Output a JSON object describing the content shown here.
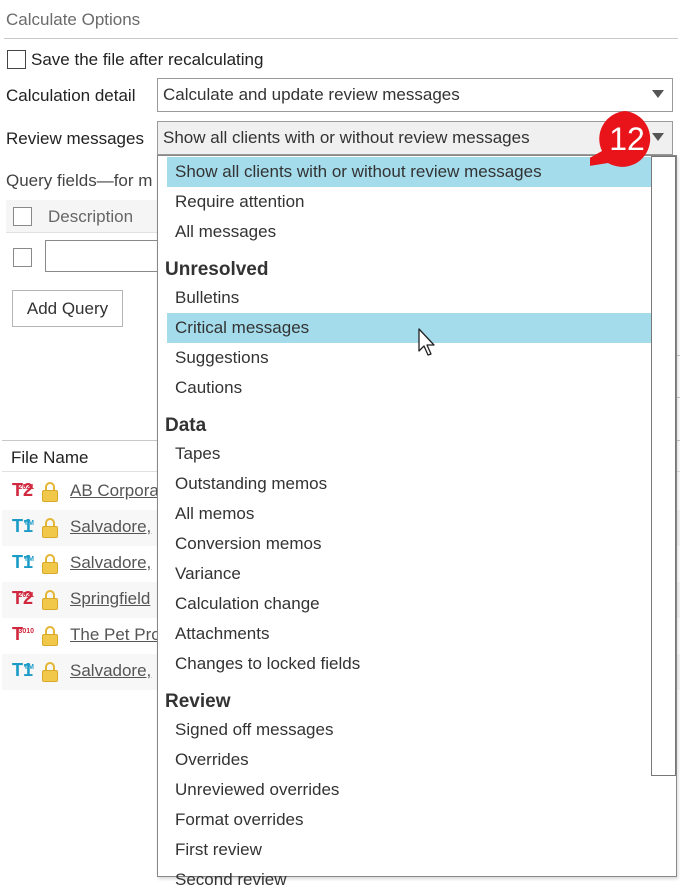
{
  "section_title": "Calculate Options",
  "save_checkbox": {
    "label": "Save the file after recalculating",
    "checked": false
  },
  "calculation_detail": {
    "label": "Calculation detail",
    "value": "Calculate and update review messages"
  },
  "review_messages": {
    "label": "Review messages",
    "value": "Show all clients with or without review messages"
  },
  "query": {
    "label": "Query fields—for m",
    "description_header": "Description",
    "add_button": "Add Query"
  },
  "file_list": {
    "header": "File Name",
    "rows": [
      {
        "badge": "T2",
        "badge_sub": "2021",
        "icon": "t2-return-icon",
        "name": "AB Corpora"
      },
      {
        "badge": "T1",
        "badge_sub": "TM",
        "icon": "t1-return-icon",
        "name": "Salvadore,"
      },
      {
        "badge": "T1",
        "badge_sub": "TM",
        "icon": "t1-return-icon",
        "name": "Salvadore,"
      },
      {
        "badge": "T2",
        "badge_sub": "2021",
        "icon": "t2-return-icon",
        "name": "Springfield"
      },
      {
        "badge": "T",
        "badge_sub": "3010",
        "icon": "t3010-return-icon",
        "name": "The Pet Pro"
      },
      {
        "badge": "T1",
        "badge_sub": "TM",
        "icon": "t1-return-icon",
        "name": "Salvadore,"
      }
    ]
  },
  "dropdown": {
    "selected": "Show all clients with or without review messages",
    "hovered": "Critical messages",
    "top_items": [
      "Show all clients with or without review messages",
      "Require attention",
      "All messages"
    ],
    "groups": [
      {
        "title": "Unresolved",
        "items": [
          "Bulletins",
          "Critical messages",
          "Suggestions",
          "Cautions"
        ]
      },
      {
        "title": "Data",
        "items": [
          "Tapes",
          "Outstanding memos",
          "All memos",
          "Conversion memos",
          "Variance",
          "Calculation change",
          "Attachments",
          "Changes to locked fields"
        ]
      },
      {
        "title": "Review",
        "items": [
          "Signed off messages",
          "Overrides",
          "Unreviewed overrides",
          "Format overrides",
          "First review",
          "Second review"
        ]
      }
    ]
  },
  "callout": {
    "number": "12",
    "color": "#e8141a"
  },
  "colors": {
    "highlight": "#a4dcec",
    "t1": "#1a9bc6",
    "t2": "#d0283e",
    "lock": "#f2c84b"
  }
}
